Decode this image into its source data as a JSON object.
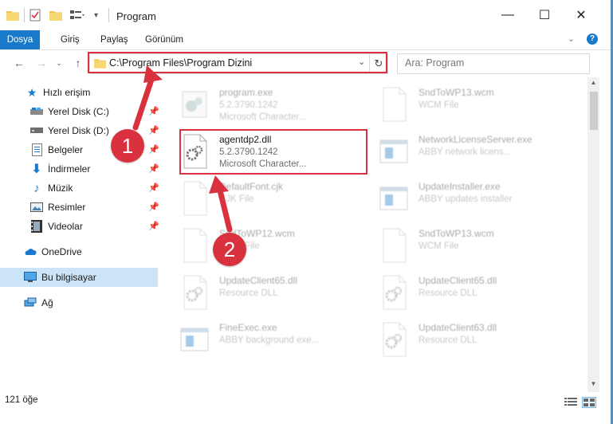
{
  "window": {
    "title": "Program",
    "minimize_glyph": "—",
    "maximize_glyph": "☐",
    "close_glyph": "✕"
  },
  "ribbon": {
    "tabs": [
      {
        "label": "Dosya",
        "active": true
      },
      {
        "label": "Giriş",
        "active": false
      },
      {
        "label": "Paylaş",
        "active": false
      },
      {
        "label": "Görünüm",
        "active": false
      }
    ]
  },
  "address": {
    "path": "C:\\Program Files\\Program Dizini"
  },
  "search": {
    "placeholder": "Ara: Program"
  },
  "nav": {
    "quick_access": "Hızlı erişim",
    "items": [
      {
        "label": "Yerel Disk (C:)",
        "icon": "hard-drive-icon"
      },
      {
        "label": "Yerel Disk (D:)",
        "icon": "hard-drive-icon"
      },
      {
        "label": "Belgeler",
        "icon": "documents-icon"
      },
      {
        "label": "İndirmeler",
        "icon": "download-icon"
      },
      {
        "label": "Müzik",
        "icon": "music-icon"
      },
      {
        "label": "Resimler",
        "icon": "pictures-icon"
      },
      {
        "label": "Videolar",
        "icon": "videos-icon"
      }
    ],
    "onedrive": "OneDrive",
    "this_pc": "Bu bilgisayar",
    "network": "Ağ"
  },
  "files": [
    {
      "name": "program.exe",
      "line1": "5.2.3790.1242",
      "line2": "Microsoft Character...",
      "kind": "exe",
      "faded": true
    },
    {
      "name": "SndToWP13.wcm",
      "line1": "WCM File",
      "line2": "",
      "kind": "blank",
      "faded": true
    },
    {
      "name": "agentdp2.dll",
      "line1": "5.2.3790.1242",
      "line2": "Microsoft Character...",
      "kind": "dll",
      "faded": false
    },
    {
      "name": "NetworkLicenseServer.exe",
      "line1": "ABBY network licens...",
      "line2": "",
      "kind": "app",
      "faded": true
    },
    {
      "name": "DefaultFont.cjk",
      "line1": "CJK File",
      "line2": "",
      "kind": "blank",
      "faded": true
    },
    {
      "name": "UpdateInstaller.exe",
      "line1": "ABBY updates installer",
      "line2": "",
      "kind": "app",
      "faded": true
    },
    {
      "name": "SndToWP12.wcm",
      "line1": "WCM File",
      "line2": "",
      "kind": "blank",
      "faded": true
    },
    {
      "name": "SndToWP13.wcm",
      "line1": "WCM File",
      "line2": "",
      "kind": "blank",
      "faded": true
    },
    {
      "name": "UpdateClient65.dll",
      "line1": "Resource DLL",
      "line2": "",
      "kind": "dll",
      "faded": true
    },
    {
      "name": "UpdateClient65.dll",
      "line1": "Resource DLL",
      "line2": "",
      "kind": "dll",
      "faded": true
    },
    {
      "name": "FineExec.exe",
      "line1": "ABBY background exe...",
      "line2": "",
      "kind": "app",
      "faded": true
    },
    {
      "name": "UpdateClient63.dll",
      "line1": "Resource DLL",
      "line2": "",
      "kind": "dll",
      "faded": true
    }
  ],
  "status": {
    "count": "121 öğe"
  },
  "annotations": {
    "step1": "1",
    "step2": "2",
    "color": "#d9323e"
  },
  "colors": {
    "accent": "#1979ca",
    "selection": "#cce4f7"
  }
}
